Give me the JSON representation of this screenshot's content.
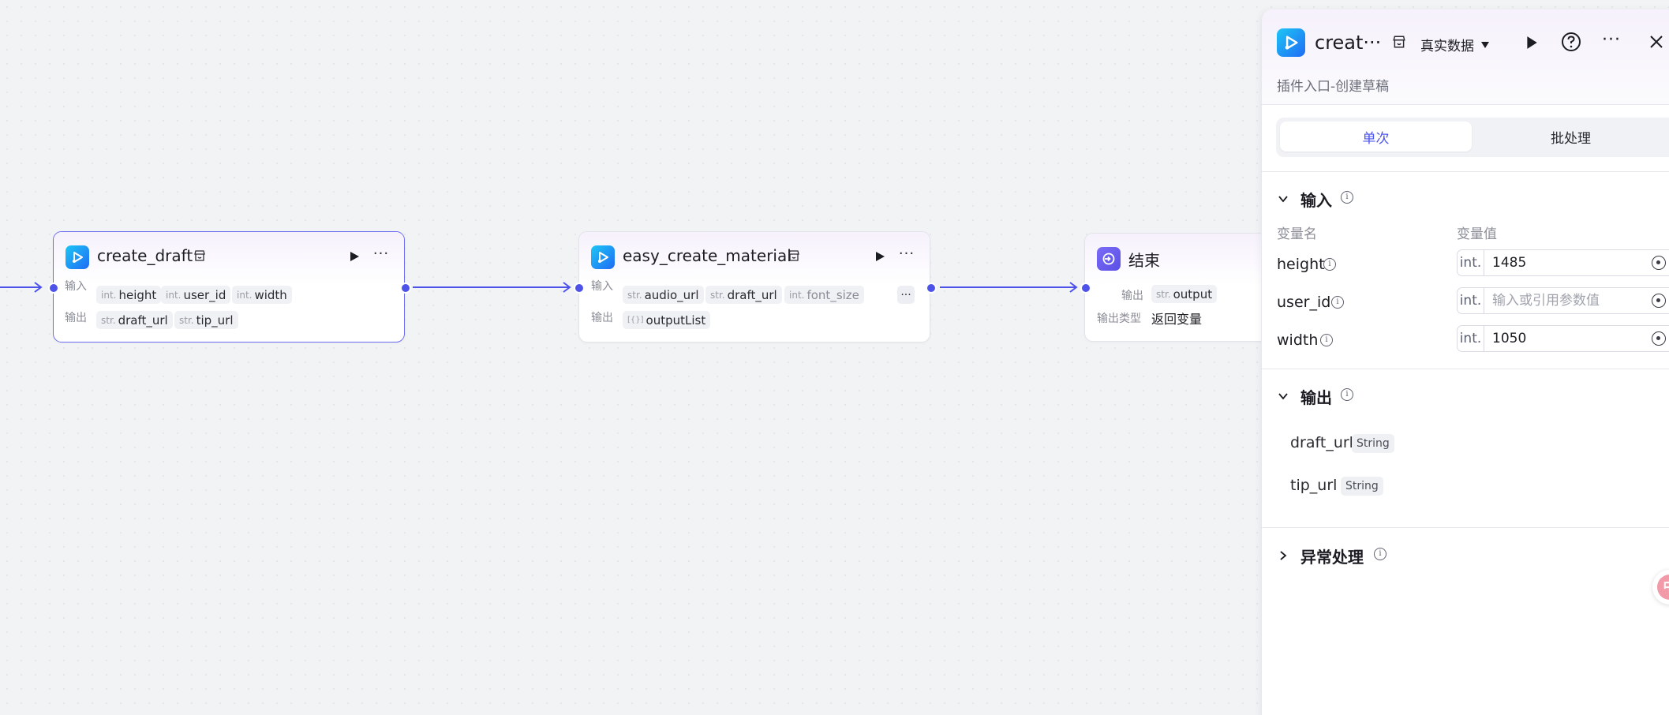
{
  "colors": {
    "accent": "#4d53e8",
    "canvas_bg": "#f2f3f5",
    "plugin_icon_gradient": [
      "#1ec6f5",
      "#1f6bf5"
    ],
    "end_icon": "#6a5cf0"
  },
  "nodes": {
    "create_draft": {
      "title": "create_draft",
      "input_label": "输入",
      "output_label": "输出",
      "inputs": [
        {
          "type": "int.",
          "name": "height"
        },
        {
          "type": "int.",
          "name": "user_id"
        },
        {
          "type": "int.",
          "name": "width"
        }
      ],
      "outputs": [
        {
          "type": "str.",
          "name": "draft_url"
        },
        {
          "type": "str.",
          "name": "tip_url"
        }
      ]
    },
    "easy_create_material": {
      "title": "easy_create_material",
      "input_label": "输入",
      "output_label": "输出",
      "inputs": [
        {
          "type": "str.",
          "name": "audio_url"
        },
        {
          "type": "str.",
          "name": "draft_url"
        },
        {
          "type": "int.",
          "name": "font_size"
        }
      ],
      "more_label": "···",
      "outputs": [
        {
          "type": "[{}]",
          "name": "outputList"
        }
      ]
    },
    "end": {
      "title": "结束",
      "output_label": "输出",
      "outputs": [
        {
          "type": "str.",
          "name": "output"
        }
      ],
      "output_type_label": "输出类型",
      "output_type_value": "返回变量"
    }
  },
  "panel": {
    "title": "creat···",
    "data_mode": "真实数据",
    "subtitle": "插件入口-创建草稿",
    "tabs": [
      {
        "label": "单次",
        "active": true
      },
      {
        "label": "批处理",
        "active": false
      }
    ],
    "input_section": {
      "title": "输入",
      "col_name": "变量名",
      "col_value": "变量值",
      "rows": [
        {
          "name": "height",
          "type": "int.",
          "value": "1485",
          "placeholder": "输入或引用参数值"
        },
        {
          "name": "user_id",
          "type": "int.",
          "value": "",
          "placeholder": "输入或引用参数值"
        },
        {
          "name": "width",
          "type": "int.",
          "value": "1050",
          "placeholder": "输入或引用参数值"
        }
      ]
    },
    "output_section": {
      "title": "输出",
      "rows": [
        {
          "name": "draft_url",
          "type": "String"
        },
        {
          "name": "tip_url",
          "type": "String"
        }
      ]
    },
    "exception_section": {
      "title": "异常处理"
    }
  },
  "float_button": {
    "label": "中"
  }
}
